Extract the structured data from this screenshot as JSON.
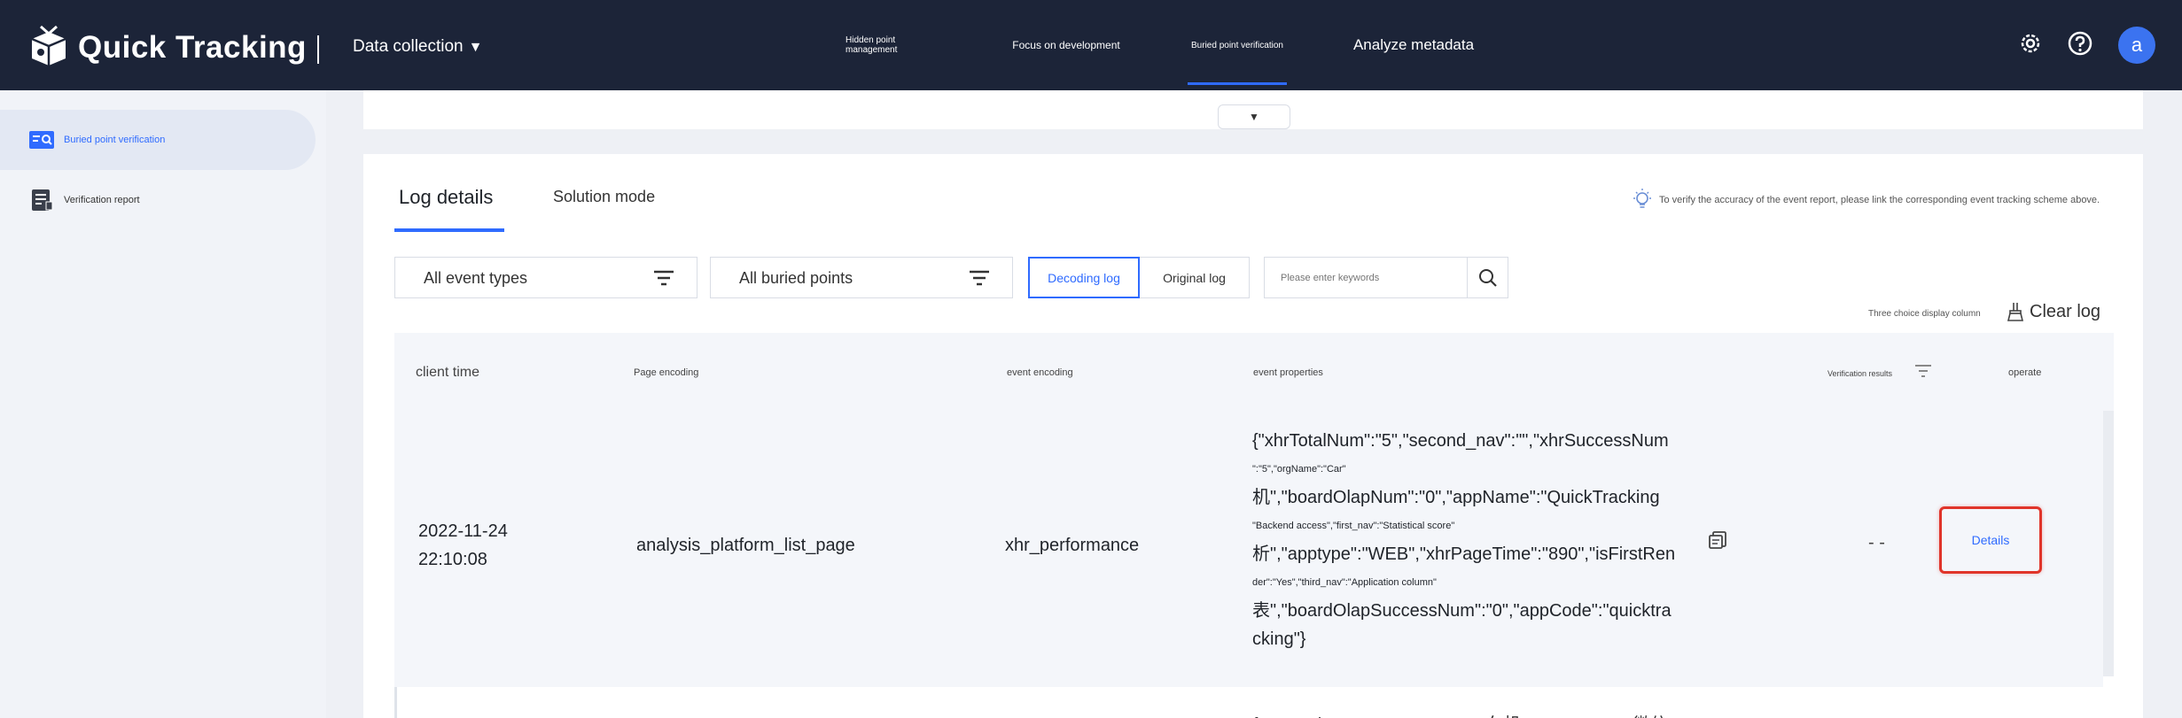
{
  "header": {
    "app_title": "Quick Tracking",
    "module": "Data collection",
    "nav_tabs": [
      {
        "label": "Hidden point management"
      },
      {
        "label": "Focus on development"
      },
      {
        "label": "Buried point verification"
      },
      {
        "label": "Analyze metadata"
      }
    ],
    "active_tab": "Buried point verification",
    "avatar_letter": "a",
    "icons": [
      "settings-icon",
      "help-icon"
    ]
  },
  "sidebar": {
    "items": [
      {
        "label": "Buried point verification",
        "icon": "verification-icon",
        "active": true
      },
      {
        "label": "Verification report",
        "icon": "report-icon",
        "active": false
      }
    ]
  },
  "panel": {
    "collapse_icon": "caret-down-icon"
  },
  "tabs": [
    {
      "label": "Log details",
      "active": true
    },
    {
      "label": "Solution mode",
      "active": false
    }
  ],
  "tip": "To verify the accuracy of the event report, please link the corresponding event tracking scheme above.",
  "filters": {
    "event_types": "All event types",
    "buried_points": "All buried points",
    "log_modes": [
      "Decoding log",
      "Original log"
    ],
    "active_log_mode": "Decoding log",
    "search_placeholder": "Please enter keywords"
  },
  "toolbar": {
    "column_choice": "Three choice display column",
    "clear_log": "Clear log"
  },
  "table": {
    "columns": [
      "client time",
      "Page encoding",
      "event encoding",
      "event properties",
      "Verification results",
      "operate"
    ],
    "rows": [
      {
        "client_time_date": "2022-11-24",
        "client_time_time": "22:10:08",
        "page_encoding": "analysis_platform_list_page",
        "event_encoding": "xhr_performance",
        "properties_lines": [
          "{\"xhrTotalNum\":\"5\",\"second_nav\":\"\",\"xhrSuccessNum",
          "\":\"5\",\"orgName\":\"Car\"",
          "机\",\"boardOlapNum\":\"0\",\"appName\":\"QuickTracking",
          "\"Backend access\",\"first_nav\":\"Statistical score\"",
          "析\",\"apptype\":\"WEB\",\"xhrPageTime\":\"890\",\"isFirstRen",
          "der\":\"Yes\",\"third_nav\":\"Application column\"",
          "表\",\"boardOlapSuccessNum\":\"0\",\"appCode\":\"quicktra",
          "cking\"}"
        ],
        "verification_result": "- -",
        "operate_label": "Details"
      }
    ],
    "next_row_partial": "{\"second_nav\":\"\",\"orgName\":\"车机\",\"appName\":\"微信"
  },
  "colors": {
    "topbar": "#1c2438",
    "accent": "#2f6bff",
    "highlight": "#e0342a"
  }
}
